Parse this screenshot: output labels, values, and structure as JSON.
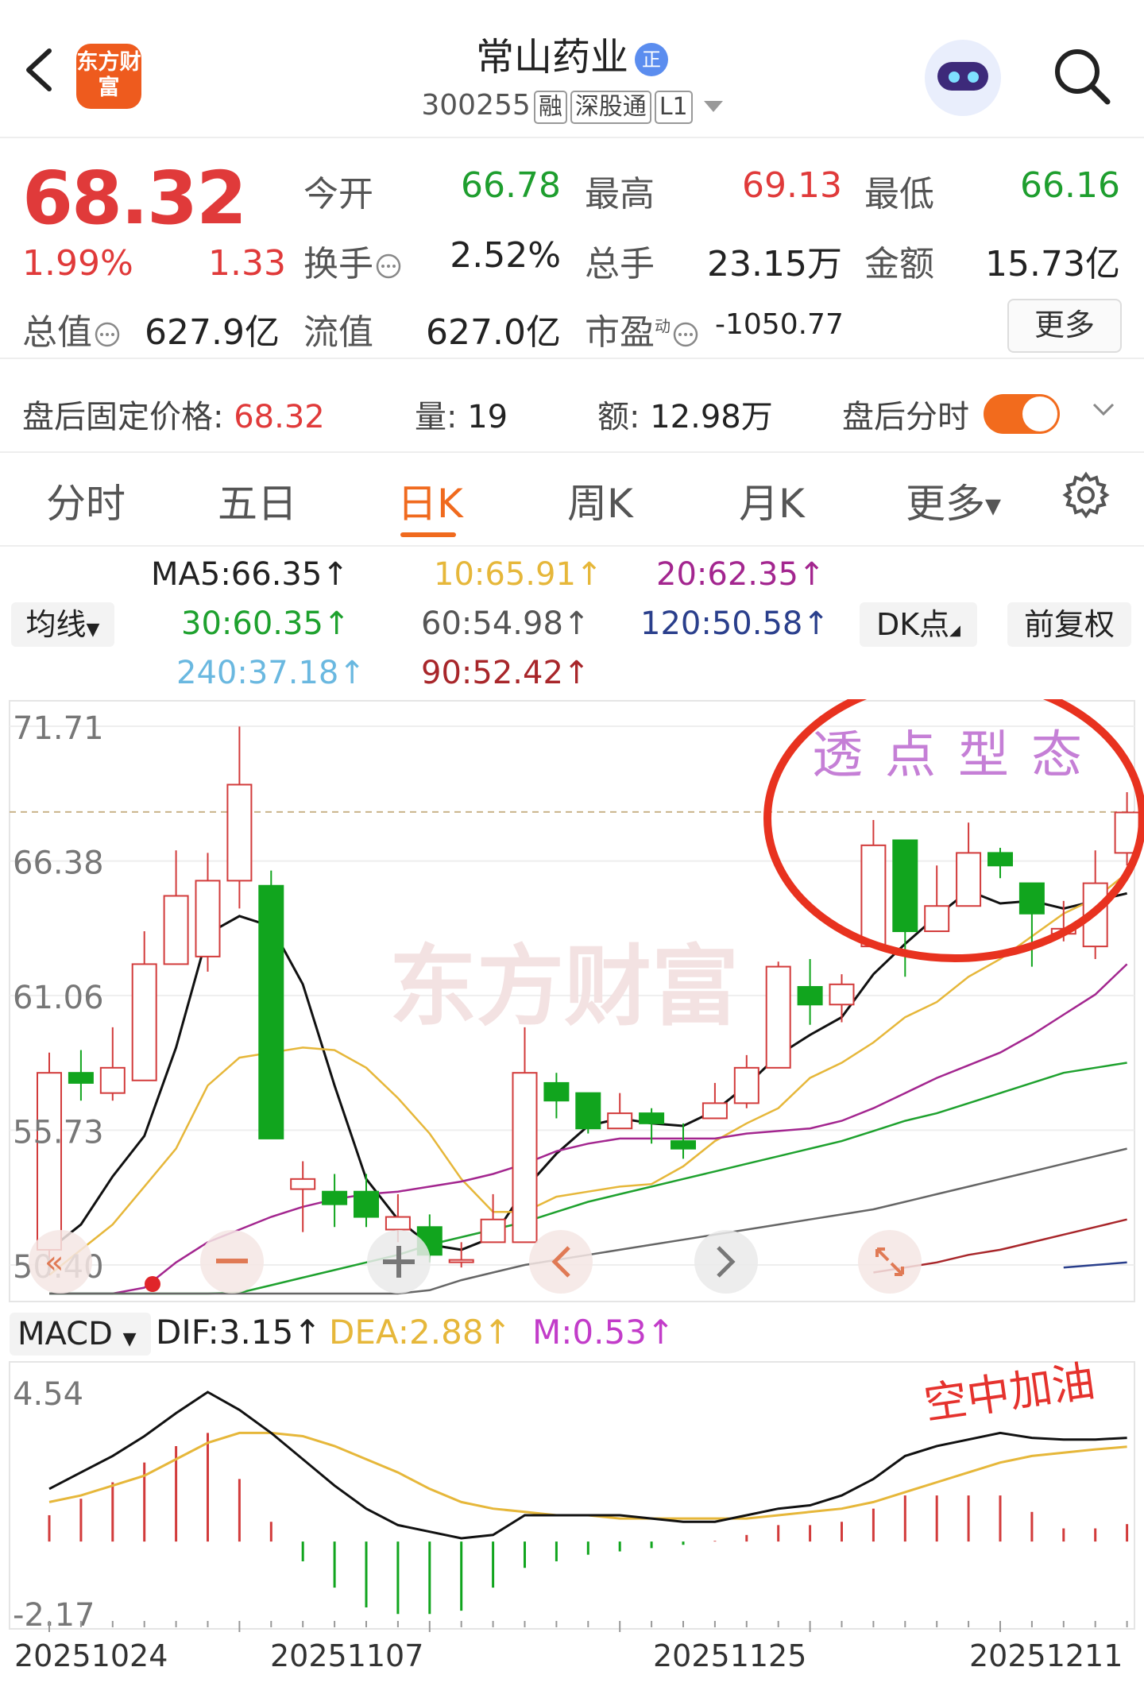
{
  "header": {
    "logo_text": "东方财富",
    "stock_name": "常山药业",
    "name_badge": "正",
    "code": "300255",
    "tags": [
      "融",
      "深股通",
      "L1"
    ]
  },
  "quote": {
    "price": "68.32",
    "change_pct": "1.99%",
    "change": "1.33",
    "open_label": "今开",
    "open": "66.78",
    "high_label": "最高",
    "high": "69.13",
    "low_label": "最低",
    "low": "66.16",
    "turnover_label": "换手",
    "turnover": "2.52%",
    "volume_label": "总手",
    "volume": "23.15万",
    "amount_label": "金额",
    "amount": "15.73亿",
    "mktcap_label": "总值",
    "mktcap": "627.9亿",
    "float_label": "流值",
    "float": "627.0亿",
    "pe_label": "市盈",
    "pe_sup": "动",
    "pe": "-1050.77",
    "more_label": "更多"
  },
  "after_hours": {
    "price_label": "盘后固定价格:",
    "price": "68.32",
    "vol_label": "量:",
    "vol": "19",
    "amt_label": "额:",
    "amt": "12.98万",
    "timeshare_label": "盘后分时"
  },
  "tabs": [
    "分时",
    "五日",
    "日K",
    "周K",
    "月K",
    "更多"
  ],
  "active_tab": "日K",
  "ma_legend": {
    "selector": "均线",
    "ma5": "MA5:66.35↑",
    "ma10": "10:65.91↑",
    "ma20": "20:62.35↑",
    "ma30": "30:60.35↑",
    "ma60": "60:54.98↑",
    "ma120": "120:50.58↑",
    "ma240": "240:37.18↑",
    "ma90": "90:52.42↑",
    "dk_label": "DK点",
    "adjust_label": "前复权"
  },
  "colors": {
    "up": "#d23b3b",
    "down": "#11a51e",
    "ma5": "#111111",
    "ma10": "#e6b73a",
    "ma20": "#a3268f",
    "ma30": "#1ea12e",
    "ma60": "#666666",
    "ma90": "#a8262a",
    "ma120": "#2a3f8c",
    "ma240": "#6ab8e0",
    "accent": "#f06a1e"
  },
  "annotations": {
    "pattern_note": "透点型态",
    "macd_note": "空中加油"
  },
  "macd_header": {
    "selector": "MACD",
    "dif": "DIF:3.15↑",
    "dea": "DEA:2.88↑",
    "m": "M:0.53↑"
  },
  "chart_data": [
    {
      "type": "candlestick",
      "y_ticks": [
        "71.71",
        "66.38",
        "61.06",
        "55.73",
        "50.40"
      ],
      "ylim": [
        50.4,
        71.71
      ],
      "reference_line": 68.32,
      "candles": [
        {
          "o": 51.0,
          "c": 58.0,
          "h": 58.8,
          "l": 50.0
        },
        {
          "o": 58.0,
          "c": 57.6,
          "h": 58.9,
          "l": 56.9
        },
        {
          "o": 57.2,
          "c": 58.2,
          "h": 59.8,
          "l": 56.9
        },
        {
          "o": 57.7,
          "c": 62.3,
          "h": 63.6,
          "l": 57.7
        },
        {
          "o": 62.3,
          "c": 65.0,
          "h": 66.8,
          "l": 62.3
        },
        {
          "o": 62.6,
          "c": 65.6,
          "h": 66.7,
          "l": 62.0
        },
        {
          "o": 65.6,
          "c": 69.4,
          "h": 71.7,
          "l": 64.5
        },
        {
          "o": 65.4,
          "c": 55.4,
          "h": 66.0,
          "l": 55.4
        },
        {
          "o": 53.4,
          "c": 53.8,
          "h": 54.5,
          "l": 51.7
        },
        {
          "o": 53.3,
          "c": 52.8,
          "h": 54.0,
          "l": 51.9
        },
        {
          "o": 53.3,
          "c": 52.3,
          "h": 54.0,
          "l": 51.9
        },
        {
          "o": 51.8,
          "c": 52.3,
          "h": 53.2,
          "l": 51.3
        },
        {
          "o": 51.9,
          "c": 50.8,
          "h": 52.4,
          "l": 50.5
        },
        {
          "o": 50.6,
          "c": 50.6,
          "h": 51.3,
          "l": 50.3
        },
        {
          "o": 51.3,
          "c": 52.2,
          "h": 53.2,
          "l": 51.3
        },
        {
          "o": 51.3,
          "c": 58.0,
          "h": 59.8,
          "l": 51.3
        },
        {
          "o": 57.6,
          "c": 56.9,
          "h": 58.0,
          "l": 56.2
        },
        {
          "o": 57.2,
          "c": 55.8,
          "h": 57.2,
          "l": 55.6
        },
        {
          "o": 55.8,
          "c": 56.4,
          "h": 57.2,
          "l": 55.8
        },
        {
          "o": 56.4,
          "c": 56.0,
          "h": 56.6,
          "l": 55.2
        },
        {
          "o": 55.3,
          "c": 55.0,
          "h": 56.0,
          "l": 54.6
        },
        {
          "o": 56.2,
          "c": 56.8,
          "h": 57.6,
          "l": 56.2
        },
        {
          "o": 56.8,
          "c": 58.2,
          "h": 58.7,
          "l": 56.6
        },
        {
          "o": 58.2,
          "c": 62.2,
          "h": 62.4,
          "l": 58.2
        },
        {
          "o": 61.4,
          "c": 60.7,
          "h": 62.5,
          "l": 59.9
        },
        {
          "o": 60.7,
          "c": 61.5,
          "h": 61.9,
          "l": 60.0
        },
        {
          "o": 63.0,
          "c": 67.0,
          "h": 68.0,
          "l": 63.0
        },
        {
          "o": 67.2,
          "c": 63.6,
          "h": 67.2,
          "l": 61.8
        },
        {
          "o": 63.6,
          "c": 64.6,
          "h": 66.2,
          "l": 63.6
        },
        {
          "o": 64.6,
          "c": 66.7,
          "h": 67.9,
          "l": 64.6
        },
        {
          "o": 66.7,
          "c": 66.2,
          "h": 66.9,
          "l": 65.7
        },
        {
          "o": 65.5,
          "c": 64.3,
          "h": 65.5,
          "l": 62.2
        },
        {
          "o": 63.5,
          "c": 63.7,
          "h": 64.8,
          "l": 63.2
        },
        {
          "o": 63.0,
          "c": 65.5,
          "h": 66.8,
          "l": 62.5
        },
        {
          "o": 66.7,
          "c": 68.3,
          "h": 69.1,
          "l": 66.2
        }
      ],
      "series": [
        {
          "name": "MA5",
          "values": [
            51,
            52,
            53.9,
            55.5,
            59,
            63.5,
            64.2,
            63.8,
            61.5,
            57.5,
            53.8,
            52.2,
            51.2,
            51.0,
            51.5,
            53.4,
            54.8,
            55.9,
            56.2,
            56.0,
            55.9,
            56.5,
            57.5,
            58.7,
            59.5,
            60.2,
            61.9,
            63.1,
            64.2,
            65.2,
            64.7,
            64.8,
            64.5,
            64.8,
            65.1
          ]
        },
        {
          "name": "MA10",
          "values": [
            50.0,
            51.0,
            52.0,
            53.5,
            55.0,
            57.5,
            58.6,
            58.8,
            59.0,
            58.9,
            58.2,
            57.0,
            55.6,
            53.8,
            52.5,
            52.5,
            53.1,
            53.3,
            53.5,
            53.6,
            54.3,
            55.3,
            56.0,
            56.6,
            57.8,
            58.4,
            59.2,
            60.2,
            60.8,
            61.8,
            62.5,
            63.4,
            64.3,
            64.9,
            65.9
          ]
        },
        {
          "name": "MA20",
          "values": [
            45,
            46,
            48,
            49.5,
            50.5,
            51.3,
            51.8,
            52.3,
            52.7,
            53.0,
            53.2,
            53.3,
            53.5,
            53.7,
            54.0,
            54.4,
            54.9,
            55.2,
            55.4,
            55.4,
            55.4,
            55.4,
            55.6,
            55.7,
            55.8,
            56.1,
            56.6,
            57.2,
            57.8,
            58.3,
            58.8,
            59.5,
            60.3,
            61.1,
            62.3
          ]
        },
        {
          "name": "MA30",
          "values": [
            44,
            45,
            46,
            47.3,
            48.2,
            49.0,
            49.3,
            49.6,
            49.9,
            50.2,
            50.5,
            50.8,
            51.2,
            51.5,
            51.8,
            52.1,
            52.5,
            52.9,
            53.2,
            53.5,
            53.8,
            54.1,
            54.4,
            54.7,
            55.0,
            55.3,
            55.7,
            56.1,
            56.4,
            56.8,
            57.2,
            57.6,
            58.0,
            58.2,
            58.4
          ]
        },
        {
          "name": "MA60",
          "values": [
            44,
            44.5,
            45,
            45.5,
            46,
            46.5,
            47,
            47.4,
            47.8,
            48.2,
            48.6,
            49.0,
            49.4,
            49.8,
            50.1,
            50.4,
            50.6,
            50.8,
            51.0,
            51.2,
            51.4,
            51.6,
            51.8,
            52.0,
            52.2,
            52.4,
            52.6,
            52.9,
            53.2,
            53.5,
            53.8,
            54.1,
            54.4,
            54.7,
            55.0
          ]
        },
        {
          "name": "MA90",
          "values": [
            null,
            null,
            null,
            null,
            null,
            null,
            null,
            null,
            null,
            null,
            null,
            null,
            null,
            null,
            null,
            null,
            null,
            null,
            null,
            null,
            null,
            null,
            null,
            null,
            null,
            null,
            50.1,
            50.3,
            50.5,
            50.8,
            51.0,
            51.3,
            51.6,
            51.9,
            52.2
          ]
        },
        {
          "name": "MA120",
          "values": [
            null,
            null,
            null,
            null,
            null,
            null,
            null,
            null,
            null,
            null,
            null,
            null,
            null,
            null,
            null,
            null,
            null,
            null,
            null,
            null,
            null,
            null,
            null,
            null,
            null,
            null,
            null,
            null,
            null,
            null,
            null,
            null,
            50.3,
            50.4,
            50.5
          ]
        }
      ]
    },
    {
      "type": "macd",
      "y_ticks": [
        "4.54",
        "-2.17"
      ],
      "ylim": [
        -2.17,
        4.54
      ],
      "dif": [
        1.6,
        2.1,
        2.6,
        3.2,
        3.9,
        4.54,
        4.0,
        3.3,
        2.5,
        1.7,
        1.0,
        0.5,
        0.3,
        0.1,
        0.2,
        0.8,
        0.8,
        0.8,
        0.8,
        0.7,
        0.6,
        0.6,
        0.8,
        1.0,
        1.1,
        1.4,
        1.9,
        2.6,
        2.9,
        3.1,
        3.3,
        3.15,
        3.1,
        3.1,
        3.15
      ],
      "dea": [
        1.2,
        1.4,
        1.7,
        2.0,
        2.5,
        3.0,
        3.3,
        3.3,
        3.2,
        2.9,
        2.5,
        2.1,
        1.6,
        1.2,
        1.0,
        0.9,
        0.8,
        0.8,
        0.7,
        0.7,
        0.7,
        0.7,
        0.7,
        0.8,
        0.9,
        1.0,
        1.2,
        1.5,
        1.8,
        2.1,
        2.4,
        2.6,
        2.7,
        2.8,
        2.88
      ],
      "m": [
        0.8,
        1.3,
        1.8,
        2.4,
        2.9,
        3.3,
        1.9,
        0.6,
        -0.6,
        -1.4,
        -2.0,
        -2.2,
        -2.2,
        -2.1,
        -1.4,
        -0.8,
        -0.6,
        -0.4,
        -0.3,
        -0.2,
        -0.1,
        0.02,
        0.2,
        0.5,
        0.5,
        0.6,
        1.0,
        1.4,
        1.4,
        1.4,
        1.4,
        0.9,
        0.4,
        0.4,
        0.53
      ]
    }
  ],
  "x_dates": [
    "20251024",
    "20251107",
    "20251125",
    "20251211"
  ]
}
